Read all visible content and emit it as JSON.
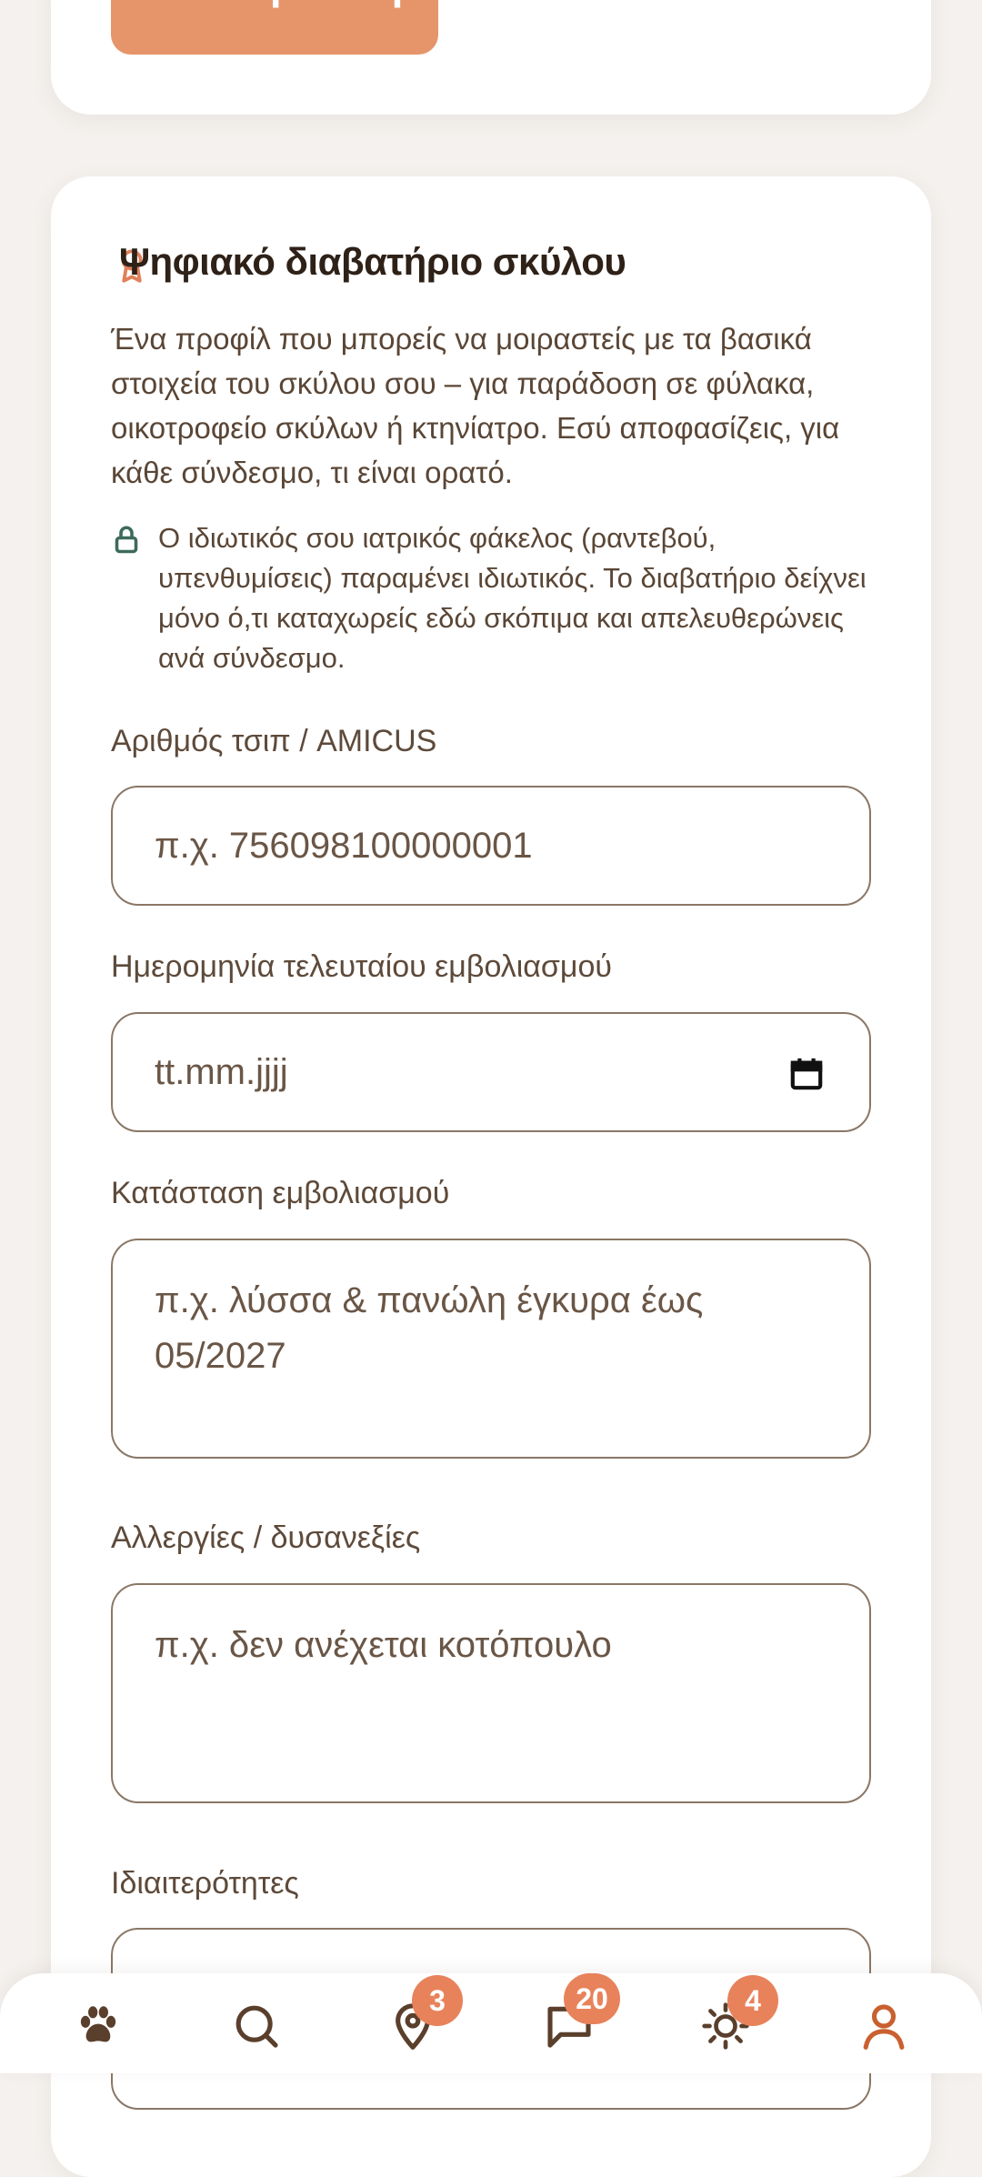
{
  "top_card": {
    "save_label": "Αποθήκευση"
  },
  "passport": {
    "title": "Ψηφιακό διαβατήριο σκύλου",
    "intro": "Ένα προφίλ που μπορείς να μοιραστείς με τα βασικά στοιχεία του σκύλου σου – για παράδοση σε φύλακα, οικοτροφείο σκύλων ή κτηνίατρο. Εσύ αποφασίζεις, για κάθε σύνδεσμο, τι είναι ορατό.",
    "privacy_note": "Ο ιδιωτικός σου ιατρικός φάκελος (ραντεβού, υπενθυμίσεις) παραμένει ιδιωτικός. Το διαβατήριο δείχνει μόνο ό,τι καταχωρείς εδώ σκόπιμα και απελευθερώνεις ανά σύνδεσμο.",
    "fields": {
      "chip": {
        "label": "Αριθμός τσιπ / AMICUS",
        "placeholder": "π.χ. 756098100000001"
      },
      "vaccination_date": {
        "label": "Ημερομηνία τελευταίου εμβολιασμού",
        "placeholder": "tt.mm.jjjj"
      },
      "vaccination_status": {
        "label": "Κατάσταση εμβολιασμού",
        "placeholder": "π.χ. λύσσα & πανώλη έγκυρα έως 05/2027"
      },
      "allergies": {
        "label": "Αλλεργίες / δυσανεξίες",
        "placeholder": "π.χ. δεν ανέχεται κοτόπουλο"
      },
      "specifics": {
        "label": "Ιδιαιτερότητες"
      }
    }
  },
  "bottom_nav": {
    "items": [
      {
        "icon": "paw-icon"
      },
      {
        "icon": "search-icon"
      },
      {
        "icon": "map-pin-icon",
        "badge": "3"
      },
      {
        "icon": "chat-icon",
        "badge": "20"
      },
      {
        "icon": "sun-icon",
        "badge": "4"
      },
      {
        "icon": "user-icon"
      }
    ]
  },
  "colors": {
    "accent": "#e6956b",
    "badge": "#e8825b",
    "text": "#3a2a1e",
    "lock": "#3d6b5c"
  }
}
